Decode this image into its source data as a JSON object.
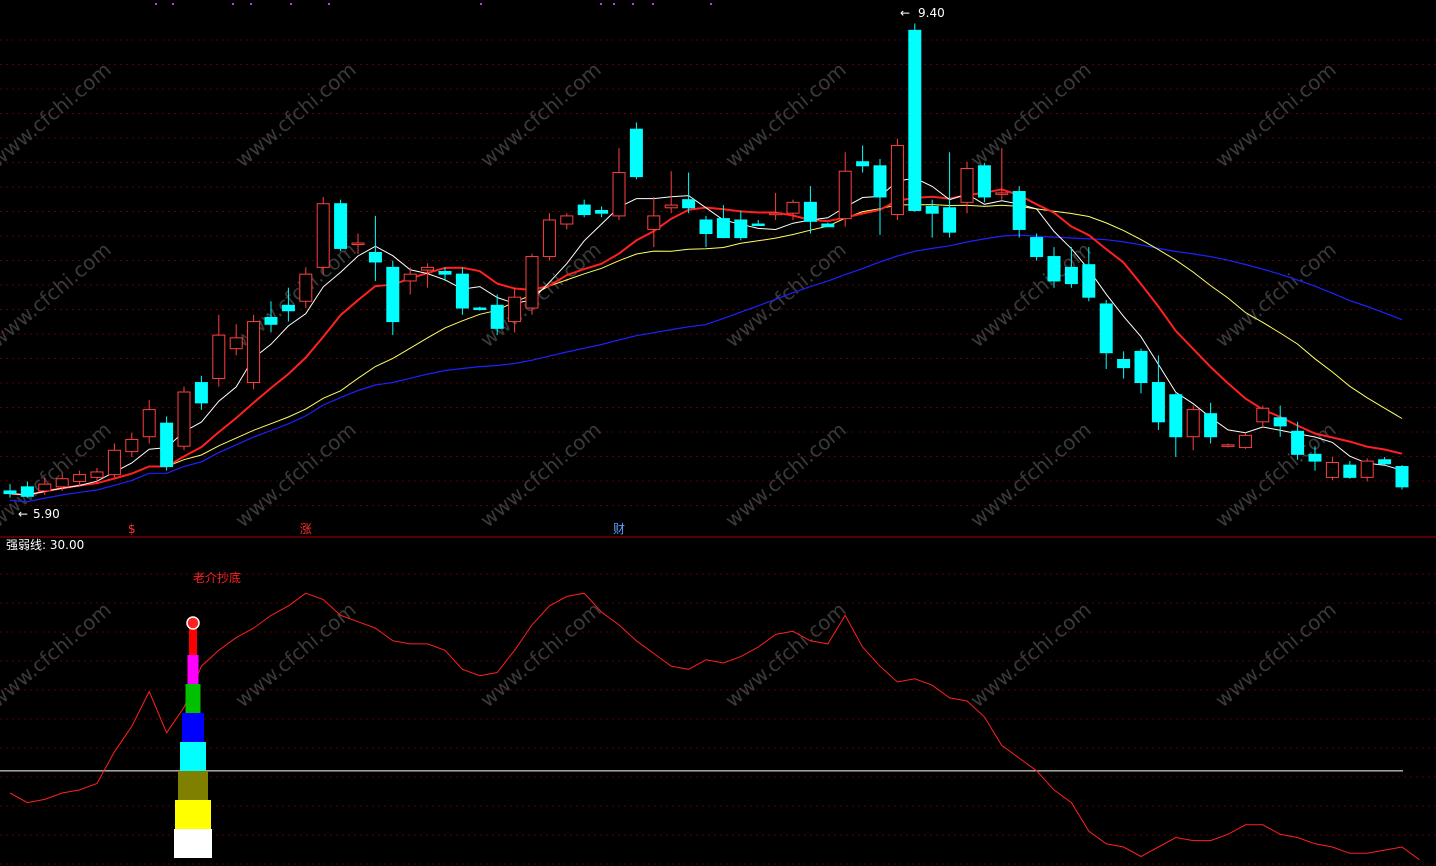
{
  "main_panel": {
    "high_marker": "9.40",
    "low_marker": "5.90",
    "high_arrow": "←",
    "low_arrow": "←",
    "signals": [
      {
        "idx": 7,
        "text": "$",
        "color": "#ff3030"
      },
      {
        "idx": 17,
        "text": "涨",
        "color": "#ff3030"
      },
      {
        "idx": 35,
        "text": "财",
        "color": "#5aa0ff"
      }
    ]
  },
  "sub_panel": {
    "indicator_label": "强弱线: 30.00",
    "annotation": "老介抄底",
    "annotation_color": "#ff2020"
  },
  "watermark": "www.cfchi.com",
  "colors": {
    "up": "#ff4040",
    "down": "#00ffff",
    "ma5": "#ffffff",
    "ma10": "#ff2020",
    "ma20": "#ffff66",
    "ma60": "#2020ff",
    "strength_line": "#ff2020",
    "threshold_line": "#ffffff",
    "panel_divider": "#b00000",
    "grid": "#5a0000"
  },
  "chart_data": [
    {
      "type": "candlestick",
      "title": "",
      "ylim": [
        5.75,
        9.5
      ],
      "candles": [
        {
          "o": 5.95,
          "h": 6.0,
          "l": 5.9,
          "c": 5.93
        },
        {
          "o": 5.98,
          "h": 6.02,
          "l": 5.9,
          "c": 5.91
        },
        {
          "o": 5.95,
          "h": 6.05,
          "l": 5.92,
          "c": 6.0
        },
        {
          "o": 5.98,
          "h": 6.08,
          "l": 5.95,
          "c": 6.04
        },
        {
          "o": 6.02,
          "h": 6.1,
          "l": 5.98,
          "c": 6.07
        },
        {
          "o": 6.05,
          "h": 6.12,
          "l": 6.0,
          "c": 6.09
        },
        {
          "o": 6.07,
          "h": 6.3,
          "l": 6.05,
          "c": 6.25
        },
        {
          "o": 6.24,
          "h": 6.38,
          "l": 6.2,
          "c": 6.33
        },
        {
          "o": 6.35,
          "h": 6.62,
          "l": 6.3,
          "c": 6.55
        },
        {
          "o": 6.45,
          "h": 6.5,
          "l": 6.1,
          "c": 6.13
        },
        {
          "o": 6.28,
          "h": 6.72,
          "l": 6.25,
          "c": 6.68
        },
        {
          "o": 6.75,
          "h": 6.8,
          "l": 6.55,
          "c": 6.6
        },
        {
          "o": 6.78,
          "h": 7.25,
          "l": 6.72,
          "c": 7.1
        },
        {
          "o": 7.0,
          "h": 7.18,
          "l": 6.95,
          "c": 7.08
        },
        {
          "o": 6.75,
          "h": 7.25,
          "l": 6.7,
          "c": 7.2
        },
        {
          "o": 7.23,
          "h": 7.35,
          "l": 7.12,
          "c": 7.18
        },
        {
          "o": 7.32,
          "h": 7.45,
          "l": 7.2,
          "c": 7.28
        },
        {
          "o": 7.35,
          "h": 7.6,
          "l": 7.3,
          "c": 7.55
        },
        {
          "o": 7.6,
          "h": 8.12,
          "l": 7.55,
          "c": 8.07
        },
        {
          "o": 8.07,
          "h": 8.1,
          "l": 7.72,
          "c": 7.74
        },
        {
          "o": 7.78,
          "h": 7.85,
          "l": 7.7,
          "c": 7.78
        },
        {
          "o": 7.71,
          "h": 7.98,
          "l": 7.5,
          "c": 7.64
        },
        {
          "o": 7.6,
          "h": 7.65,
          "l": 7.1,
          "c": 7.2
        },
        {
          "o": 7.5,
          "h": 7.6,
          "l": 7.4,
          "c": 7.55
        },
        {
          "o": 7.58,
          "h": 7.63,
          "l": 7.45,
          "c": 7.6
        },
        {
          "o": 7.57,
          "h": 7.6,
          "l": 7.5,
          "c": 7.55
        },
        {
          "o": 7.55,
          "h": 7.6,
          "l": 7.25,
          "c": 7.3
        },
        {
          "o": 7.3,
          "h": 7.31,
          "l": 7.28,
          "c": 7.29
        },
        {
          "o": 7.32,
          "h": 7.4,
          "l": 7.1,
          "c": 7.15
        },
        {
          "o": 7.2,
          "h": 7.45,
          "l": 7.12,
          "c": 7.38
        },
        {
          "o": 7.3,
          "h": 7.7,
          "l": 7.25,
          "c": 7.68
        },
        {
          "o": 7.68,
          "h": 8.0,
          "l": 7.65,
          "c": 7.95
        },
        {
          "o": 7.92,
          "h": 8.0,
          "l": 7.88,
          "c": 7.98
        },
        {
          "o": 8.06,
          "h": 8.1,
          "l": 7.97,
          "c": 7.99
        },
        {
          "o": 8.02,
          "h": 8.05,
          "l": 7.97,
          "c": 8.0
        },
        {
          "o": 7.98,
          "h": 8.48,
          "l": 7.95,
          "c": 8.3
        },
        {
          "o": 8.62,
          "h": 8.67,
          "l": 8.25,
          "c": 8.27
        },
        {
          "o": 7.88,
          "h": 8.12,
          "l": 7.75,
          "c": 7.98
        },
        {
          "o": 8.04,
          "h": 8.31,
          "l": 8.0,
          "c": 8.06
        },
        {
          "o": 8.1,
          "h": 8.3,
          "l": 8.0,
          "c": 8.04
        },
        {
          "o": 7.95,
          "h": 7.98,
          "l": 7.75,
          "c": 7.85
        },
        {
          "o": 7.96,
          "h": 8.06,
          "l": 7.84,
          "c": 7.82
        },
        {
          "o": 7.95,
          "h": 8.02,
          "l": 7.8,
          "c": 7.82
        },
        {
          "o": 7.92,
          "h": 7.95,
          "l": 7.91,
          "c": 7.91
        },
        {
          "o": 8.0,
          "h": 8.15,
          "l": 7.95,
          "c": 8.0
        },
        {
          "o": 8.0,
          "h": 8.1,
          "l": 7.95,
          "c": 8.08
        },
        {
          "o": 8.08,
          "h": 8.2,
          "l": 7.85,
          "c": 7.94
        },
        {
          "o": 7.92,
          "h": 7.93,
          "l": 7.9,
          "c": 7.9
        },
        {
          "o": 7.96,
          "h": 8.45,
          "l": 7.9,
          "c": 8.31
        },
        {
          "o": 8.38,
          "h": 8.5,
          "l": 8.3,
          "c": 8.35
        },
        {
          "o": 8.35,
          "h": 8.4,
          "l": 7.84,
          "c": 8.12
        },
        {
          "o": 7.99,
          "h": 8.55,
          "l": 7.95,
          "c": 8.5
        },
        {
          "o": 9.35,
          "h": 9.4,
          "l": 8.01,
          "c": 8.02
        },
        {
          "o": 8.05,
          "h": 8.1,
          "l": 7.82,
          "c": 8.0
        },
        {
          "o": 8.04,
          "h": 8.45,
          "l": 7.82,
          "c": 7.86
        },
        {
          "o": 8.08,
          "h": 8.38,
          "l": 8.0,
          "c": 8.33
        },
        {
          "o": 8.35,
          "h": 8.37,
          "l": 8.08,
          "c": 8.12
        },
        {
          "o": 8.15,
          "h": 8.48,
          "l": 8.1,
          "c": 8.15
        },
        {
          "o": 8.16,
          "h": 8.2,
          "l": 7.82,
          "c": 7.88
        },
        {
          "o": 7.82,
          "h": 7.85,
          "l": 7.65,
          "c": 7.68
        },
        {
          "o": 7.68,
          "h": 7.75,
          "l": 7.45,
          "c": 7.5
        },
        {
          "o": 7.6,
          "h": 7.75,
          "l": 7.45,
          "c": 7.48
        },
        {
          "o": 7.62,
          "h": 7.75,
          "l": 7.35,
          "c": 7.38
        },
        {
          "o": 7.33,
          "h": 7.36,
          "l": 6.85,
          "c": 6.97
        },
        {
          "o": 6.92,
          "h": 6.98,
          "l": 6.78,
          "c": 6.86
        },
        {
          "o": 6.98,
          "h": 7.0,
          "l": 6.67,
          "c": 6.75
        },
        {
          "o": 6.75,
          "h": 6.95,
          "l": 6.4,
          "c": 6.46
        },
        {
          "o": 6.66,
          "h": 6.67,
          "l": 6.2,
          "c": 6.35
        },
        {
          "o": 6.35,
          "h": 6.58,
          "l": 6.25,
          "c": 6.55
        },
        {
          "o": 6.52,
          "h": 6.6,
          "l": 6.3,
          "c": 6.35
        },
        {
          "o": 6.28,
          "h": 6.3,
          "l": 6.27,
          "c": 6.29
        },
        {
          "o": 6.27,
          "h": 6.38,
          "l": 6.26,
          "c": 6.36
        },
        {
          "o": 6.46,
          "h": 6.58,
          "l": 6.42,
          "c": 6.56
        },
        {
          "o": 6.49,
          "h": 6.58,
          "l": 6.35,
          "c": 6.43
        },
        {
          "o": 6.39,
          "h": 6.46,
          "l": 6.18,
          "c": 6.22
        },
        {
          "o": 6.22,
          "h": 6.28,
          "l": 6.1,
          "c": 6.17
        },
        {
          "o": 6.05,
          "h": 6.2,
          "l": 6.03,
          "c": 6.16
        },
        {
          "o": 6.14,
          "h": 6.17,
          "l": 6.04,
          "c": 6.05
        },
        {
          "o": 6.05,
          "h": 6.19,
          "l": 6.02,
          "c": 6.17
        },
        {
          "o": 6.18,
          "h": 6.2,
          "l": 6.14,
          "c": 6.15
        },
        {
          "o": 6.13,
          "h": 6.14,
          "l": 5.96,
          "c": 5.98
        }
      ]
    },
    {
      "type": "line",
      "title": "",
      "ylim": [
        0,
        100
      ],
      "threshold": 30,
      "series": [
        {
          "values": [
            23,
            20,
            21,
            23,
            24,
            26,
            36,
            44,
            55,
            42,
            50,
            63,
            68,
            72,
            75,
            79,
            82,
            86,
            84,
            79,
            77,
            75,
            71,
            70,
            70,
            68,
            62,
            60,
            61,
            68,
            76,
            82,
            85,
            86,
            80,
            76,
            71,
            67,
            63,
            62,
            65,
            64,
            66,
            69,
            73,
            74,
            71,
            70,
            79,
            69,
            63,
            58,
            59,
            57,
            53,
            52,
            47,
            38,
            34,
            30,
            24,
            20,
            11,
            7,
            6,
            3,
            6,
            9,
            8,
            8,
            10,
            13,
            13,
            10,
            9,
            7,
            6,
            4,
            4,
            5,
            6,
            2
          ]
        }
      ]
    }
  ]
}
